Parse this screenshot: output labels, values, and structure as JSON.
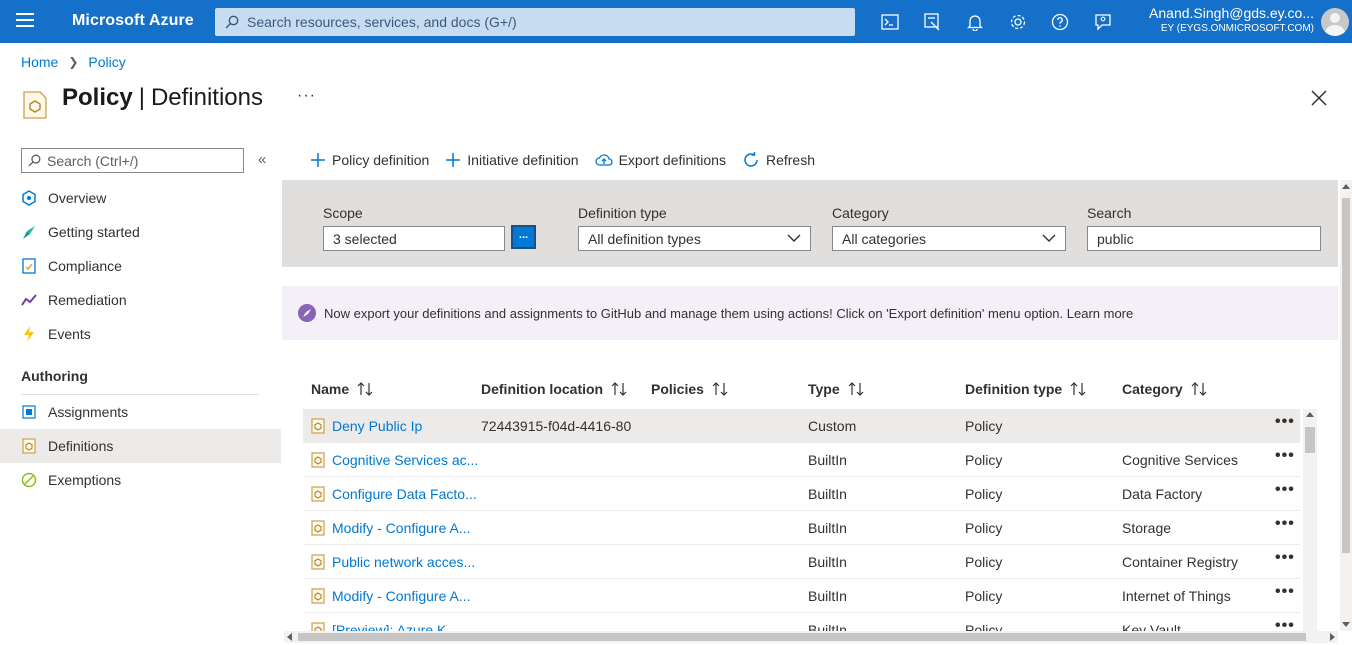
{
  "topbar": {
    "brand": "Microsoft Azure",
    "search_placeholder": "Search resources, services, and docs (G+/)",
    "icons": [
      "cloud-shell-icon",
      "directory-filter-icon",
      "notifications-icon",
      "settings-icon",
      "help-icon",
      "feedback-icon"
    ],
    "account_user": "Anand.Singh@gds.ey.co...",
    "account_tenant": "EY (EYGS.ONMICROSOFT.COM)",
    "bar_color": "#1570c9"
  },
  "breadcrumb": {
    "home": "Home",
    "current": "Policy"
  },
  "page": {
    "title_bold": "Policy",
    "separator": "|",
    "title_rest": "Definitions",
    "more": "···"
  },
  "nav": {
    "search_placeholder": "Search (Ctrl+/)",
    "collapse": "«",
    "items": [
      {
        "label": "Overview",
        "icon": "overview-icon"
      },
      {
        "label": "Getting started",
        "icon": "rocket-icon"
      },
      {
        "label": "Compliance",
        "icon": "compliance-icon"
      },
      {
        "label": "Remediation",
        "icon": "remediation-icon"
      },
      {
        "label": "Events",
        "icon": "lightning-icon"
      }
    ],
    "section_authoring": "Authoring",
    "authoring_items": [
      {
        "label": "Assignments",
        "icon": "assignments-icon"
      },
      {
        "label": "Definitions",
        "icon": "definitions-icon",
        "active": true
      },
      {
        "label": "Exemptions",
        "icon": "exemptions-icon"
      }
    ]
  },
  "commands": {
    "policy_definition": "Policy definition",
    "initiative_definition": "Initiative definition",
    "export_definitions": "Export definitions",
    "refresh": "Refresh"
  },
  "filters": {
    "scope_label": "Scope",
    "scope_value": "3 selected",
    "scope_button": "...",
    "def_type_label": "Definition type",
    "def_type_value": "All definition types",
    "category_label": "Category",
    "category_value": "All categories",
    "search_label": "Search",
    "search_value": "public"
  },
  "notice": {
    "text": "Now export your definitions and assignments to GitHub and manage them using actions! Click on 'Export definition' menu option. Learn more"
  },
  "table": {
    "headers": {
      "name": "Name",
      "location": "Definition location",
      "policies": "Policies",
      "type": "Type",
      "def_type": "Definition type",
      "category": "Category"
    },
    "rows": [
      {
        "name": "Deny Public Ip",
        "location": "72443915-f04d-4416-80...",
        "policies": "",
        "type": "Custom",
        "def_type": "Policy",
        "category": "",
        "selected": true
      },
      {
        "name": "Cognitive Services ac...",
        "location": "",
        "policies": "",
        "type": "BuiltIn",
        "def_type": "Policy",
        "category": "Cognitive Services"
      },
      {
        "name": "Configure Data Facto...",
        "location": "",
        "policies": "",
        "type": "BuiltIn",
        "def_type": "Policy",
        "category": "Data Factory"
      },
      {
        "name": "Modify - Configure A...",
        "location": "",
        "policies": "",
        "type": "BuiltIn",
        "def_type": "Policy",
        "category": "Storage"
      },
      {
        "name": "Public network acces...",
        "location": "",
        "policies": "",
        "type": "BuiltIn",
        "def_type": "Policy",
        "category": "Container Registry"
      },
      {
        "name": "Modify - Configure A...",
        "location": "",
        "policies": "",
        "type": "BuiltIn",
        "def_type": "Policy",
        "category": "Internet of Things"
      },
      {
        "name": "[Preview]: Azure K...",
        "location": "",
        "policies": "",
        "type": "BuiltIn",
        "def_type": "Policy",
        "category": "Key Vault"
      }
    ],
    "row_more": "•••"
  }
}
